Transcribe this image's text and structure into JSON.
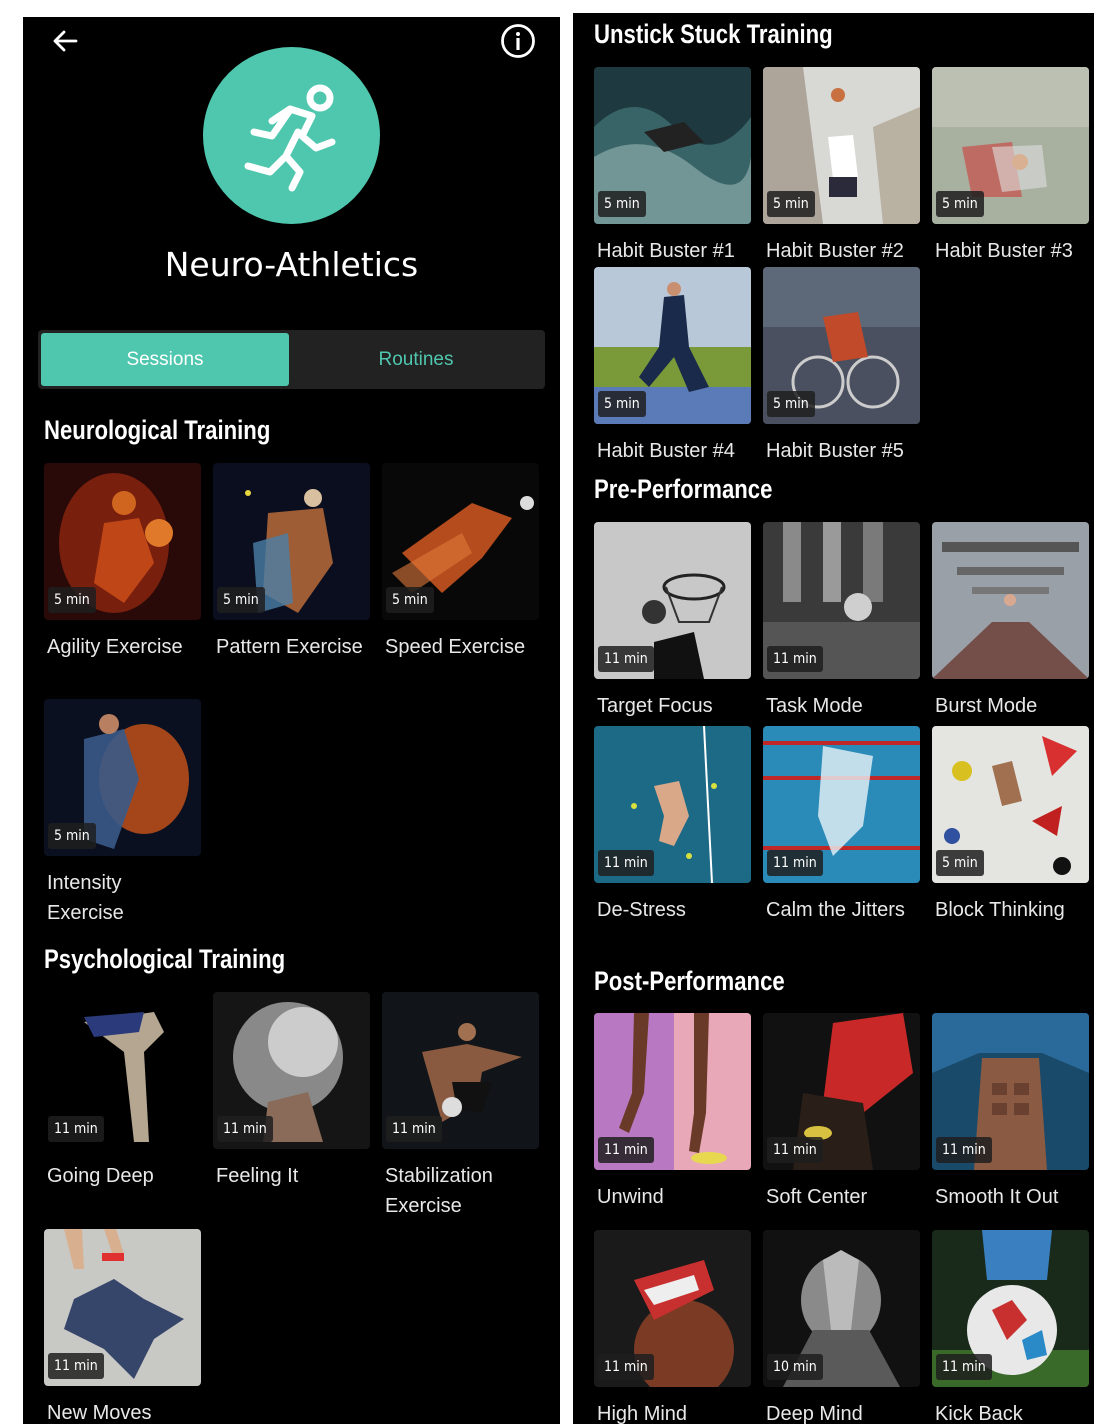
{
  "header": {
    "title": "Neuro-Athletics",
    "back_icon": "arrow-left-icon",
    "info_icon": "info-circle-icon",
    "logo_icon": "runner-icon",
    "accent_color": "#4fc7ae"
  },
  "tabs": [
    {
      "label": "Sessions",
      "active": true
    },
    {
      "label": "Routines",
      "active": false
    }
  ],
  "left_sections": [
    {
      "title": "Neurological Training",
      "items": [
        {
          "label": "Agility Exercise",
          "duration": "5 min"
        },
        {
          "label": "Pattern Exercise",
          "duration": "5 min"
        },
        {
          "label": "Speed Exercise",
          "duration": "5 min"
        },
        {
          "label": "Intensity Exercise",
          "duration": "5 min"
        }
      ]
    },
    {
      "title": "Psychological Training",
      "items": [
        {
          "label": "Going Deep",
          "duration": "11 min"
        },
        {
          "label": "Feeling It",
          "duration": "11 min"
        },
        {
          "label": "Stabilization Exercise",
          "duration": "11 min"
        },
        {
          "label": "New Moves",
          "duration": "11 min"
        }
      ]
    }
  ],
  "right_sections": [
    {
      "title": "Unstick Stuck Training",
      "items": [
        {
          "label": "Habit Buster #1",
          "duration": "5 min"
        },
        {
          "label": "Habit Buster #2",
          "duration": "5 min"
        },
        {
          "label": "Habit Buster #3",
          "duration": "5 min"
        },
        {
          "label": "Habit Buster #4",
          "duration": "5 min"
        },
        {
          "label": "Habit Buster #5",
          "duration": "5 min"
        }
      ]
    },
    {
      "title": "Pre-Performance",
      "items": [
        {
          "label": "Target Focus",
          "duration": "11 min"
        },
        {
          "label": "Task Mode",
          "duration": "11 min"
        },
        {
          "label": "Burst Mode",
          "duration": ""
        },
        {
          "label": "De-Stress",
          "duration": "11 min"
        },
        {
          "label": "Calm the Jitters",
          "duration": "11 min"
        },
        {
          "label": "Block Thinking",
          "duration": "5 min"
        }
      ]
    },
    {
      "title": "Post-Performance",
      "items": [
        {
          "label": "Unwind",
          "duration": "11 min"
        },
        {
          "label": "Soft Center",
          "duration": "11 min"
        },
        {
          "label": "Smooth It Out",
          "duration": "11 min"
        },
        {
          "label": "High Mind",
          "duration": "11 min"
        },
        {
          "label": "Deep Mind",
          "duration": "10 min"
        },
        {
          "label": "Kick Back",
          "duration": "11 min"
        }
      ]
    }
  ]
}
